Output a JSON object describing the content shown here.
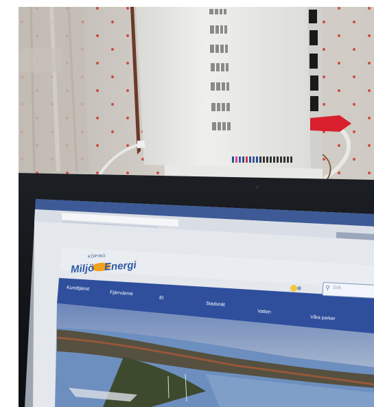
{
  "image": {
    "alt": "",
    "colors": {
      "wall": "#d4cfc8",
      "router": "#e6e6e3",
      "cable_red": "#d8202e",
      "laptop_bezel": "#121418",
      "site_blue": "#2f4f9c",
      "water": "#6d8fbf"
    }
  },
  "website": {
    "logo_top": "KÖPING",
    "logo_left": "Miljö",
    "logo_mid": "&",
    "logo_right": "Energi",
    "search_placeholder": "Sök",
    "nav": [
      "Kundtjänst",
      "Fjärrvärme",
      "El",
      "Stadsnät",
      "Vatten",
      "Våra parker"
    ]
  }
}
